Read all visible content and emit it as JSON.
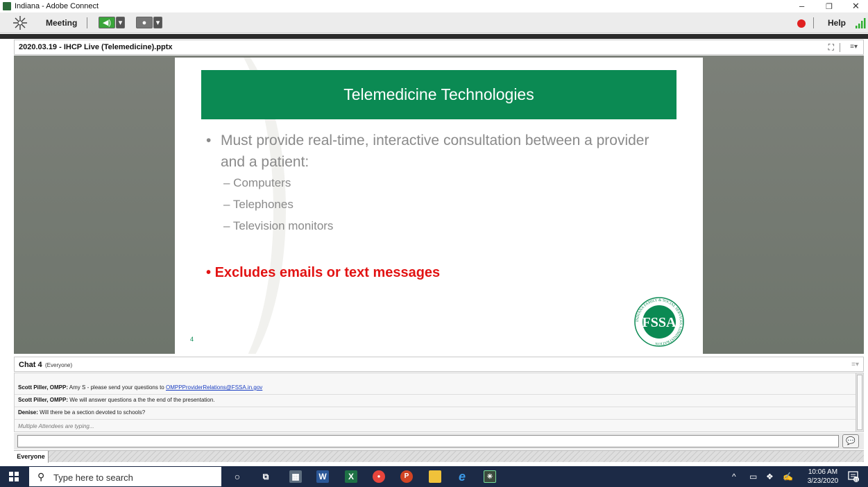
{
  "window": {
    "title": "Indiana - Adobe Connect",
    "controls": {
      "minimize": "–",
      "maximize": "❐",
      "close": "✕"
    }
  },
  "toolbar": {
    "meeting_label": "Meeting",
    "help_label": "Help",
    "icons": [
      "connect-logo-icon",
      "speaker-icon",
      "camera-icon",
      "record-indicator-icon",
      "signal-strength-icon"
    ],
    "speaker_color": "#3aa53a",
    "record_color": "#e02020"
  },
  "share_pod": {
    "title": "2020.03.19 - IHCP Live (Telemedicine).pptx",
    "slide": {
      "banner_title": "Telemedicine Technologies",
      "banner_color": "#0b8a53",
      "main_bullet": "Must provide real-time, interactive consultation between a provider and a patient:",
      "sub_bullets": [
        "– Computers",
        "– Telephones",
        "– Television monitors"
      ],
      "red_bullet": "Excludes emails or text messages",
      "red_color": "#e21313",
      "page_number": "4",
      "seal_letters": "FSSA",
      "seal_ring_text": "INDIANA FAMILY & SOCIAL SERVICES ADMINISTRATION"
    }
  },
  "chat_pod": {
    "title": "Chat 4",
    "scope": "(Everyone)",
    "messages": [
      {
        "sender": "Scott Piller, OMPP:",
        "text": " Amy S - please send your questions to ",
        "link": "OMPPProviderRelations@FSSA.in.gov"
      },
      {
        "sender": "Scott Piller, OMPP:",
        "text": " We will answer questions a the the end of the presentation.",
        "link": ""
      },
      {
        "sender": "Denise:",
        "text": " Will there be a section devoted to schools?",
        "link": ""
      }
    ],
    "typing_status": "Multiple Attendees are typing...",
    "input_value": "",
    "tab_label": "Everyone"
  },
  "taskbar": {
    "search_placeholder": "Type here to search",
    "apps": [
      "cortana-icon",
      "task-view-icon",
      "calculator-icon",
      "word-icon",
      "excel-icon",
      "chrome-icon",
      "powerpoint-icon",
      "file-explorer-icon",
      "edge-icon",
      "adobe-connect-icon"
    ],
    "time": "10:06 AM",
    "date": "3/23/2020",
    "notification_count": "11"
  }
}
